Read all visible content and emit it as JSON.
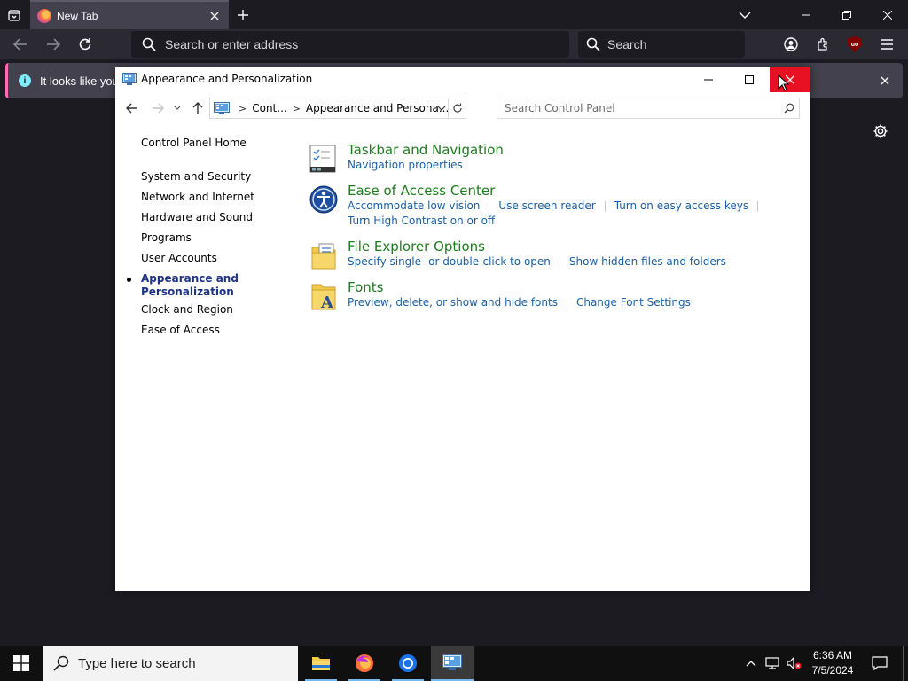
{
  "browser": {
    "tab_title": "New Tab",
    "url_placeholder": "Search or enter address",
    "search_placeholder": "Search",
    "notification_text": "It looks like you",
    "icons": {
      "tablist": "tab-list-icon",
      "tab_close": "close-icon",
      "new_tab": "plus-icon",
      "all_tabs": "chevron-down-icon",
      "back": "back-arrow-icon",
      "forward": "forward-arrow-icon",
      "reload": "reload-icon",
      "account": "account-icon",
      "extensions": "extensions-icon",
      "ublock": "ublock-origin-icon",
      "menu": "hamburger-menu-icon",
      "info": "info-icon",
      "settings": "gear-icon"
    },
    "ublock_text": "uo",
    "info_glyph": "i"
  },
  "control_panel": {
    "window_title": "Appearance and Personalization",
    "breadcrumb": [
      "Cont...",
      "Appearance and Persona..."
    ],
    "search_placeholder": "Search Control Panel",
    "sidebar": {
      "home": "Control Panel Home",
      "items": [
        {
          "label": "System and Security",
          "active": false
        },
        {
          "label": "Network and Internet",
          "active": false
        },
        {
          "label": "Hardware and Sound",
          "active": false
        },
        {
          "label": "Programs",
          "active": false
        },
        {
          "label": "User Accounts",
          "active": false
        },
        {
          "label": "Appearance and Personalization",
          "active": true
        },
        {
          "label": "Clock and Region",
          "active": false
        },
        {
          "label": "Ease of Access",
          "active": false
        }
      ]
    },
    "categories": [
      {
        "title": "Taskbar and Navigation",
        "icon": "taskbar-icon",
        "links": [
          "Navigation properties"
        ]
      },
      {
        "title": "Ease of Access Center",
        "icon": "ease-of-access-icon",
        "links": [
          "Accommodate low vision",
          "Use screen reader",
          "Turn on easy access keys",
          "Turn High Contrast on or off"
        ]
      },
      {
        "title": "File Explorer Options",
        "icon": "folder-options-icon",
        "links": [
          "Specify single- or double-click to open",
          "Show hidden files and folders"
        ]
      },
      {
        "title": "Fonts",
        "icon": "fonts-icon",
        "links": [
          "Preview, delete, or show and hide fonts",
          "Change Font Settings"
        ]
      }
    ],
    "colors": {
      "category_title": "#1e7b1e",
      "link": "#1a5fa5",
      "close_hover": "#e81123"
    }
  },
  "taskbar": {
    "search_placeholder": "Type here to search",
    "time": "6:36 AM",
    "date": "7/5/2024",
    "apps": [
      "file-explorer-icon",
      "firefox-icon",
      "chrome-icon",
      "control-panel-icon"
    ],
    "active_app": "control-panel-icon"
  }
}
